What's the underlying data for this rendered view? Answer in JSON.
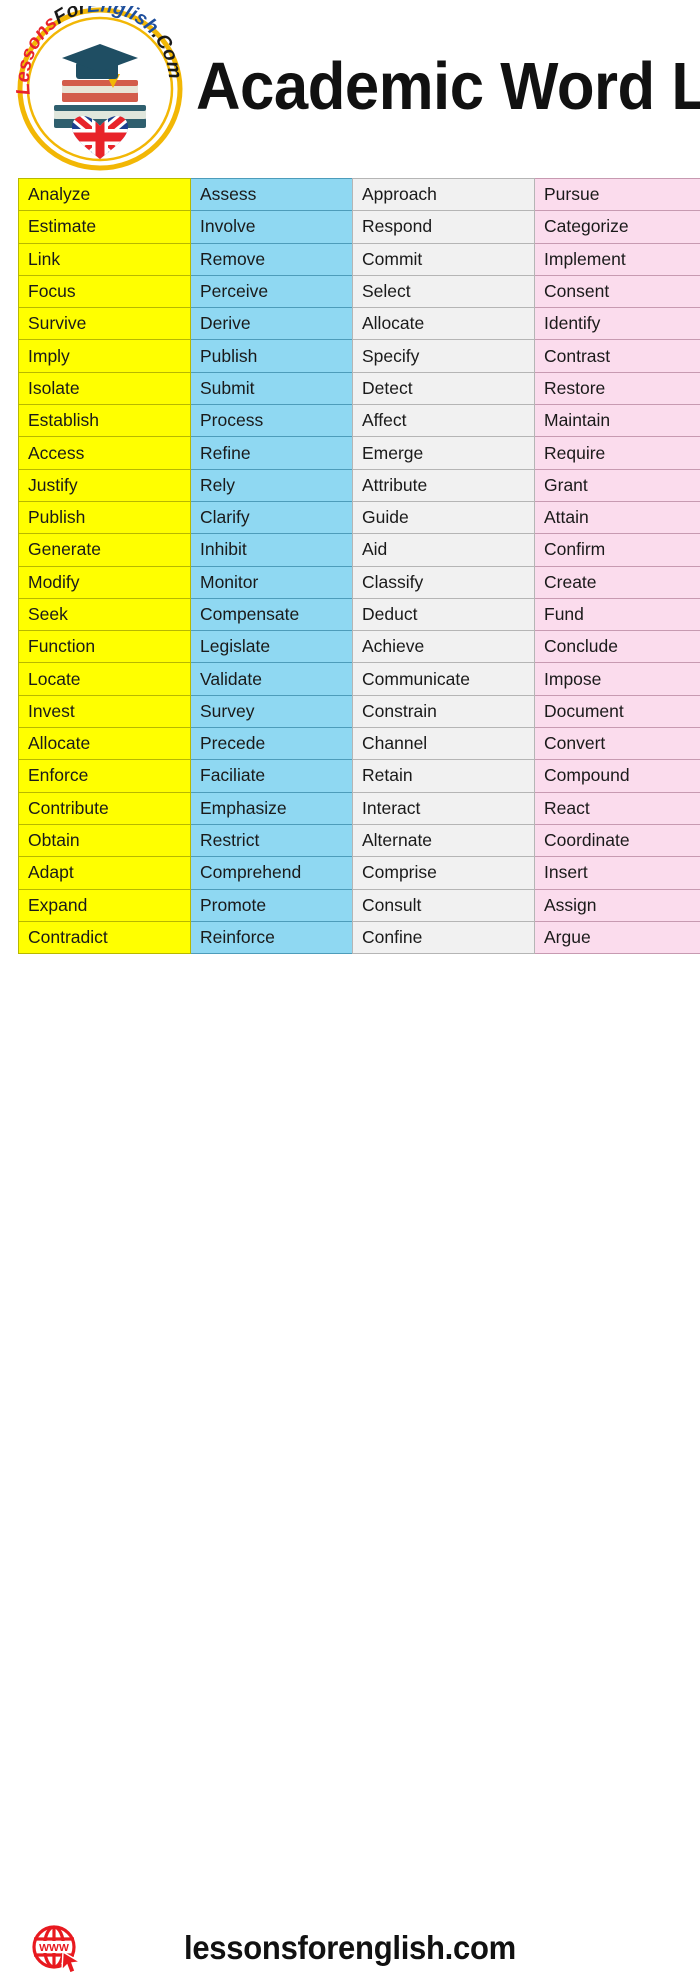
{
  "header": {
    "title": "Academic Word List",
    "logo": {
      "alt": "LessonsForEnglish.Com logo",
      "text_top": "LessonsForEnglish",
      "text_tail": ".Com",
      "ring_color": "#f2b705",
      "text_red": "#e8232a",
      "text_blue": "#1d4e9c",
      "cap_color": "#1f4e63"
    }
  },
  "colors": {
    "col_a_bg": "#ffff00",
    "col_b_bg": "#8fd8f2",
    "col_c_bg": "#f1f1f1",
    "col_d_bg": "#fbdced",
    "title_color": "#111111",
    "globe_red": "#e8191f"
  },
  "tables": {
    "left": {
      "col_a": [
        "Analyze",
        "Estimate",
        "Link",
        "Focus",
        "Survive",
        "Imply",
        "Isolate",
        "Establish",
        "Access",
        "Justify",
        "Publish",
        "Generate",
        "Modify",
        "Seek",
        "Function",
        "Locate",
        "Invest",
        "Allocate",
        "Enforce",
        "Contribute",
        "Obtain",
        "Adapt",
        "Expand",
        "Contradict"
      ],
      "col_b": [
        "Assess",
        "Involve",
        "Remove",
        "Perceive",
        "Derive",
        "Publish",
        "Submit",
        "Process",
        "Refine",
        "Rely",
        "Clarify",
        "Inhibit",
        "Monitor",
        "Compensate",
        "Legislate",
        "Validate",
        "Survey",
        "Precede",
        "Faciliate",
        "Emphasize",
        "Restrict",
        "Comprehend",
        "Promote",
        "Reinforce"
      ]
    },
    "right": {
      "col_c": [
        "Approach",
        "Respond",
        "Commit",
        "Select",
        "Allocate",
        "Specify",
        "Detect",
        "Affect",
        "Emerge",
        "Attribute",
        "Guide",
        "Aid",
        "Classify",
        "Deduct",
        "Achieve",
        "Communicate",
        "Constrain",
        "Channel",
        "Retain",
        "Interact",
        "Alternate",
        "Comprise",
        "Consult",
        "Confine"
      ],
      "col_d": [
        "Pursue",
        "Categorize",
        "Implement",
        "Consent",
        "Identify",
        "Contrast",
        "Restore",
        "Maintain",
        "Require",
        "Grant",
        "Attain",
        "Confirm",
        "Create",
        "Fund",
        "Conclude",
        "Impose",
        "Document",
        "Convert",
        "Compound",
        "React",
        "Coordinate",
        "Insert",
        "Assign",
        "Argue"
      ]
    }
  },
  "footer": {
    "url": "lessonsforenglish.com",
    "globe_label": "WWW"
  }
}
